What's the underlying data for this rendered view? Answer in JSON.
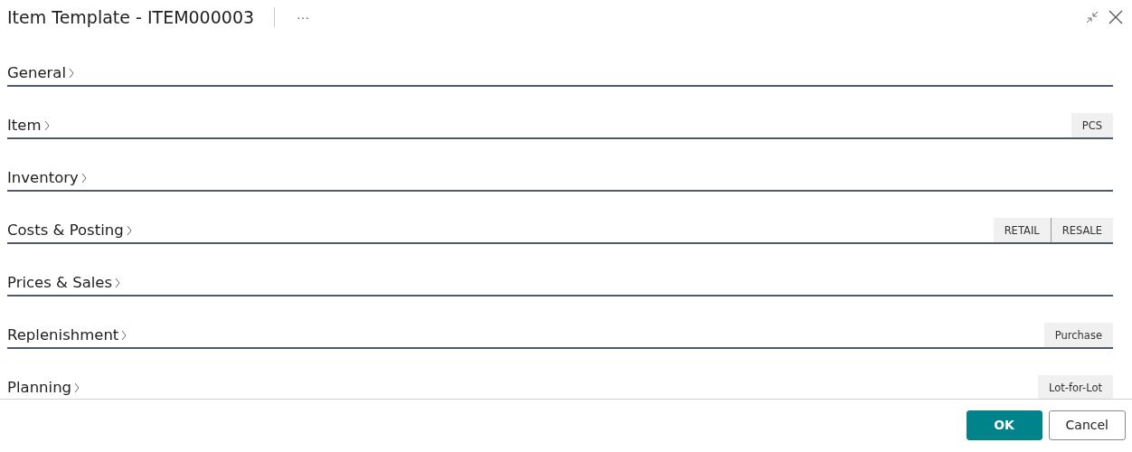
{
  "dialog": {
    "title": "Item Template - ITEM000003",
    "more": "···"
  },
  "sections": [
    {
      "title": "General"
    },
    {
      "title": "Item",
      "values": [
        "PCS"
      ]
    },
    {
      "title": "Inventory"
    },
    {
      "title": "Costs & Posting",
      "values": [
        "RETAIL",
        "RESALE"
      ]
    },
    {
      "title": "Prices & Sales"
    },
    {
      "title": "Replenishment",
      "values": [
        "Purchase"
      ]
    },
    {
      "title": "Planning",
      "values": [
        "Lot-for-Lot"
      ]
    }
  ],
  "buttons": [
    {
      "label": "OK",
      "kind": "primary"
    },
    {
      "label": "Cancel",
      "kind": "secondary"
    }
  ]
}
